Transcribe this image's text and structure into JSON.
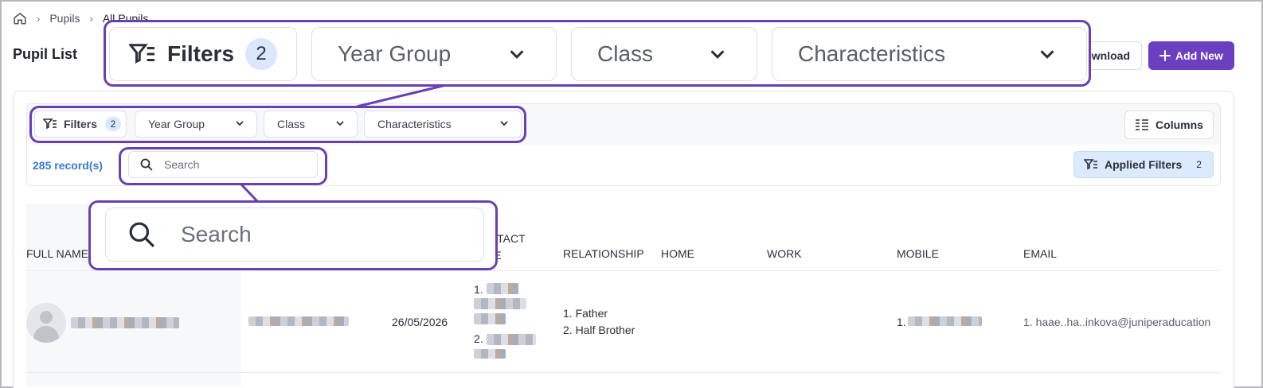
{
  "breadcrumb": {
    "items": [
      "Pupils",
      "All Pupils"
    ]
  },
  "page": {
    "title": "Pupil List"
  },
  "actions": {
    "download_label": "Download",
    "add_new_label": "Add New"
  },
  "filters": {
    "filters_label": "Filters",
    "filters_count": "2",
    "year_group_label": "Year Group",
    "class_label": "Class",
    "characteristics_label": "Characteristics",
    "columns_label": "Columns"
  },
  "search": {
    "placeholder": "Search"
  },
  "records": {
    "count_label": "285 record(s)"
  },
  "applied_filters": {
    "label": "Applied Filters",
    "count": "2"
  },
  "table": {
    "headers": {
      "full_name": "FULL NAME",
      "contact_type": "CONTACT\nTYPE",
      "relationship": "RELATIONSHIP",
      "home": "HOME",
      "work": "WORK",
      "mobile": "MOBILE",
      "email": "EMAIL"
    },
    "rows": [
      {
        "date": "26/05/2026",
        "contact_prefix_1": "1.",
        "contact_prefix_2": "2.",
        "relationship_1": "1. Father",
        "relationship_2": "2. Half Brother",
        "mobile_prefix": "1.",
        "email_text": "1. haae..ha..inkova@juniperaducation"
      }
    ]
  },
  "colors": {
    "accent": "#6b3fbf",
    "link": "#3a78d8",
    "callout": "#6a3fb4",
    "applied_bg": "#dbeafc"
  }
}
